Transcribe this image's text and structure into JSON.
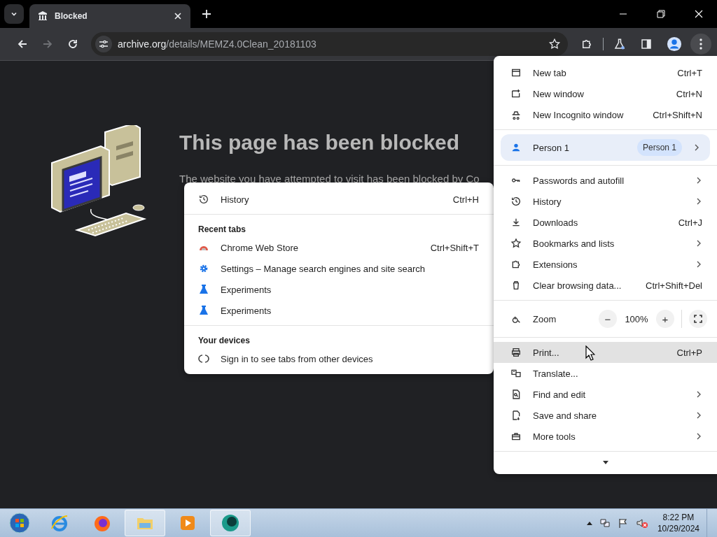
{
  "tab": {
    "title": "Blocked",
    "selected": true
  },
  "address_bar": {
    "host": "archive.org",
    "path": "/details/MEMZ4.0Clean_20181103"
  },
  "page": {
    "title": "This page has been blocked",
    "line_1": "The website you have attempted to visit has been blocked by Co"
  },
  "history_submenu": {
    "top": {
      "label": "History",
      "shortcut": "Ctrl+H"
    },
    "sections": [
      {
        "header": "Recent tabs",
        "items": [
          {
            "label": "Chrome Web Store",
            "shortcut": "Ctrl+Shift+T"
          },
          {
            "label": "Settings – Manage search engines and site search"
          },
          {
            "label": "Experiments"
          },
          {
            "label": "Experiments"
          }
        ]
      },
      {
        "header": "Your devices",
        "items": [
          {
            "label": "Sign in to see tabs from other devices"
          }
        ]
      }
    ]
  },
  "main_menu": {
    "sections": [
      [
        {
          "kind": "item",
          "label": "New tab",
          "shortcut": "Ctrl+T",
          "submenu": false,
          "hovered": false
        },
        {
          "kind": "item",
          "label": "New window",
          "shortcut": "Ctrl+N",
          "submenu": false,
          "hovered": false
        },
        {
          "kind": "item",
          "label": "New Incognito window",
          "shortcut": "Ctrl+Shift+N",
          "submenu": false,
          "hovered": false
        }
      ],
      [
        {
          "kind": "profile",
          "label": "Person 1",
          "badge": "Person 1",
          "submenu": true,
          "hovered": false
        }
      ],
      [
        {
          "kind": "item",
          "label": "Passwords and autofill",
          "submenu": true,
          "hovered": false
        },
        {
          "kind": "item",
          "label": "History",
          "submenu": true,
          "hovered": false
        },
        {
          "kind": "item",
          "label": "Downloads",
          "shortcut": "Ctrl+J",
          "submenu": false,
          "hovered": false
        },
        {
          "kind": "item",
          "label": "Bookmarks and lists",
          "submenu": true,
          "hovered": false
        },
        {
          "kind": "item",
          "label": "Extensions",
          "submenu": true,
          "hovered": false
        },
        {
          "kind": "item",
          "label": "Clear browsing data...",
          "shortcut": "Ctrl+Shift+Del",
          "submenu": false,
          "hovered": false
        }
      ],
      [
        {
          "kind": "zoom",
          "label": "Zoom",
          "value": "100%",
          "minus": "−",
          "plus": "+"
        }
      ],
      [
        {
          "kind": "item",
          "label": "Print...",
          "shortcut": "Ctrl+P",
          "submenu": false,
          "hovered": true
        },
        {
          "kind": "item",
          "label": "Translate...",
          "submenu": false,
          "hovered": false
        },
        {
          "kind": "item",
          "label": "Find and edit",
          "submenu": true,
          "hovered": false
        },
        {
          "kind": "item",
          "label": "Save and share",
          "submenu": true,
          "hovered": false
        },
        {
          "kind": "item",
          "label": "More tools",
          "submenu": true,
          "hovered": false
        }
      ],
      [
        {
          "kind": "expand"
        }
      ]
    ]
  },
  "taskbar": {
    "apps": [
      {
        "selected": false
      },
      {
        "selected": false
      },
      {
        "selected": true
      },
      {
        "selected": false
      },
      {
        "selected": true
      }
    ],
    "time": "8:22 PM",
    "date": "10/29/2024"
  }
}
